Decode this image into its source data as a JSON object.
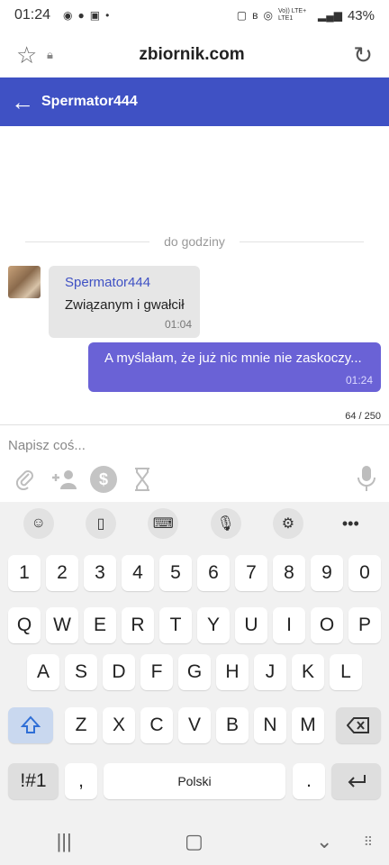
{
  "status_bar": {
    "time": "01:24",
    "icons_left": [
      "messenger-icon",
      "facebook-icon",
      "gallery-icon",
      "dot-icon"
    ],
    "icons_right": [
      "nfc-icon",
      "bluetooth-icon",
      "hotspot-icon",
      "volte-icon",
      "signal-icon"
    ],
    "network_label": "Vo)) LTE+ LTE1",
    "battery": "43%"
  },
  "browser": {
    "url": "zbiornik.com"
  },
  "chat": {
    "title": "Spermator444",
    "divider_label": "do godziny",
    "messages": [
      {
        "direction": "in",
        "sender": "Spermator444",
        "text": "Związanym i gwałcił",
        "time": "01:04"
      },
      {
        "direction": "out",
        "text": "A myślałam, że już nic mnie nie zaskoczy...",
        "time": "01:24"
      }
    ],
    "char_counter": "64 / 250"
  },
  "composer": {
    "placeholder": "Napisz coś...",
    "tools": [
      "paperclip-icon",
      "add-user-icon",
      "dollar-icon",
      "hourglass-icon"
    ],
    "mic": "microphone-icon"
  },
  "keyboard": {
    "toolbar": [
      "emoji-icon",
      "clipboard-icon",
      "keyboard-layout-icon",
      "voice-input-icon",
      "settings-icon",
      "more-icon"
    ],
    "row_numbers": [
      "1",
      "2",
      "3",
      "4",
      "5",
      "6",
      "7",
      "8",
      "9",
      "0"
    ],
    "row_1": [
      "Q",
      "W",
      "E",
      "R",
      "T",
      "Y",
      "U",
      "I",
      "O",
      "P"
    ],
    "row_2": [
      "A",
      "S",
      "D",
      "F",
      "G",
      "H",
      "J",
      "K",
      "L"
    ],
    "row_3": [
      "Z",
      "X",
      "C",
      "V",
      "B",
      "N",
      "M"
    ],
    "symbols_key": "!#1",
    "comma_key": ",",
    "space_label": "Polski",
    "period_key": ".",
    "accent_color": "#2f6fd6"
  },
  "nav_bar": {
    "buttons": [
      "recents-icon",
      "home-icon",
      "back-icon",
      "keyboard-hide-icon"
    ]
  },
  "colors": {
    "header_bg": "#3f51c4",
    "outgoing_bubble": "#6a62d6",
    "incoming_bubble": "#e6e6e6"
  }
}
